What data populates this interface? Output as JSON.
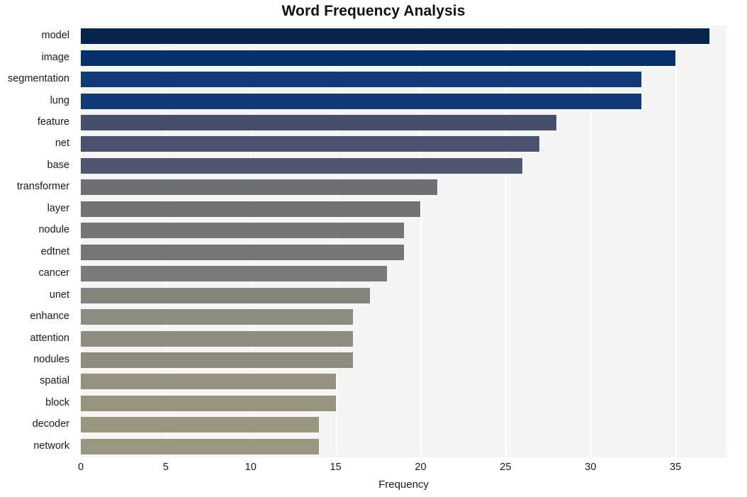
{
  "chart_data": {
    "type": "bar",
    "orientation": "horizontal",
    "title": "Word Frequency Analysis",
    "xlabel": "Frequency",
    "ylabel": "",
    "categories": [
      "model",
      "image",
      "segmentation",
      "lung",
      "feature",
      "net",
      "base",
      "transformer",
      "layer",
      "nodule",
      "edtnet",
      "cancer",
      "unet",
      "enhance",
      "attention",
      "nodules",
      "spatial",
      "block",
      "decoder",
      "network"
    ],
    "values": [
      37,
      35,
      33,
      33,
      28,
      27,
      26,
      21,
      20,
      19,
      19,
      18,
      17,
      16,
      16,
      16,
      15,
      15,
      14,
      14
    ],
    "bar_colors": [
      "#06254a",
      "#06306b",
      "#123a78",
      "#123a78",
      "#464f6d",
      "#4a5270",
      "#4f566f",
      "#6e6f73",
      "#727275",
      "#757576",
      "#757576",
      "#7a7a78",
      "#83847c",
      "#8d8c80",
      "#8e8d80",
      "#8e8d80",
      "#94927f",
      "#96947f",
      "#9a9781",
      "#9a9781"
    ],
    "xlim": [
      0,
      38
    ],
    "xticks": [
      0,
      5,
      10,
      15,
      20,
      25,
      30,
      35
    ],
    "xtick_labels": [
      "0",
      "5",
      "10",
      "15",
      "20",
      "25",
      "30",
      "35"
    ],
    "grid": true,
    "grid_axis": "x",
    "grid_color": "#ffffff",
    "legend": "none",
    "plot_background": "#f5f5f6",
    "figure_background": "#ffffff",
    "text_color": "#1a1a1a"
  }
}
